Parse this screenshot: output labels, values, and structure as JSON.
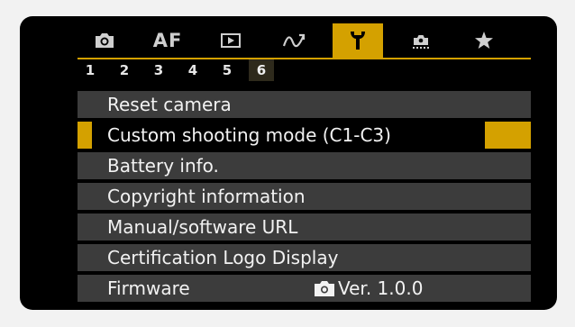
{
  "tabs": [
    {
      "icon": "camera-icon",
      "label": "",
      "active": false
    },
    {
      "icon": "af-text",
      "label": "AF",
      "active": false
    },
    {
      "icon": "play-icon",
      "label": "",
      "active": false
    },
    {
      "icon": "wireless-icon",
      "label": "",
      "active": false
    },
    {
      "icon": "wrench-icon",
      "label": "",
      "active": true
    },
    {
      "icon": "custom-function-icon",
      "label": "",
      "active": false
    },
    {
      "icon": "star-icon",
      "label": "",
      "active": false
    }
  ],
  "pages": [
    "1",
    "2",
    "3",
    "4",
    "5",
    "6"
  ],
  "active_page": "6",
  "menu": {
    "items": [
      {
        "label": "Reset camera"
      },
      {
        "label": "Custom shooting mode (C1-C3)"
      },
      {
        "label": "Battery info."
      },
      {
        "label": "Copyright information"
      },
      {
        "label": "Manual/software URL"
      },
      {
        "label": "Certification Logo Display"
      },
      {
        "label": "Firmware",
        "value": "Ver. 1.0.0"
      }
    ],
    "selected_index": 1
  },
  "colors": {
    "accent": "#d4a100",
    "row_bg": "#3c3c3c",
    "screen_bg": "#000000",
    "text": "#f2f2f2"
  }
}
